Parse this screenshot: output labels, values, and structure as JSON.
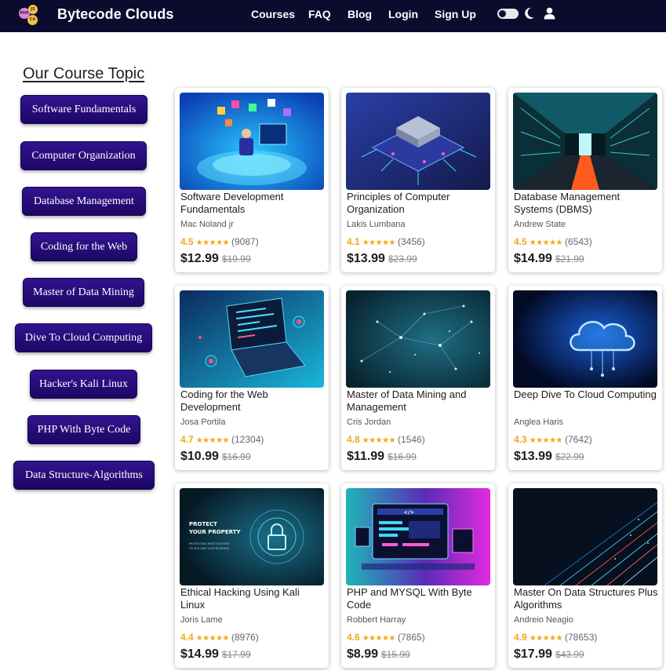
{
  "header": {
    "brand": "Bytecode Clouds",
    "logo_badges": [
      "PHP",
      "JS",
      "C#"
    ],
    "nav": [
      "Courses",
      "FAQ",
      "Blog",
      "Login",
      "Sign Up"
    ],
    "icons": [
      "theme-toggle",
      "moon-icon",
      "user-icon"
    ]
  },
  "sidebar": {
    "heading": "Our Course Topic",
    "topics": [
      "Software Fundamentals",
      "Computer Organization",
      "Database Management",
      "Coding for the Web",
      "Master of Data Mining",
      "Dive To Cloud Computing",
      "Hacker's Kali Linux",
      "PHP With Byte Code",
      "Data Structure-Algorithms"
    ]
  },
  "courses": [
    {
      "title": "Software Development Fundamentals",
      "author": "Mac Noland jr",
      "rating": "4.5",
      "reviews": "(9087)",
      "price": "$12.99",
      "old_price": "$19.99",
      "image": "developer-illustration"
    },
    {
      "title": "Principles of Computer Organization",
      "author": "Lakis Lumbana",
      "rating": "4.1",
      "reviews": "(3456)",
      "price": "$13.99",
      "old_price": "$23.99",
      "image": "cpu-chip"
    },
    {
      "title": "Database Management Systems (DBMS)",
      "author": "Andrew State",
      "rating": "4.5",
      "reviews": "(6543)",
      "price": "$14.99",
      "old_price": "$21.99",
      "image": "server-room"
    },
    {
      "title": "Coding for the Web Development",
      "author": "Josa Portila",
      "rating": "4.7",
      "reviews": "(12304)",
      "price": "$10.99",
      "old_price": "$16.99",
      "image": "laptop-code"
    },
    {
      "title": "Master of Data Mining and Management",
      "author": "Cris Jordan",
      "rating": "4.8",
      "reviews": "(1546)",
      "price": "$11.99",
      "old_price": "$16.99",
      "image": "data-particles"
    },
    {
      "title": "Deep Dive To Cloud Computing",
      "author": "Anglea Haris",
      "rating": "4.3",
      "reviews": "(7642)",
      "price": "$13.99",
      "old_price": "$22.99",
      "image": "cloud-circuit"
    },
    {
      "title": "Ethical Hacking Using Kali Linux",
      "author": "Joris Lame",
      "rating": "4.4",
      "reviews": "(8976)",
      "price": "$14.99",
      "old_price": "$17.99",
      "image": "security-lock"
    },
    {
      "title": "PHP and MYSQL With Byte Code",
      "author": "Robbert Harray",
      "rating": "4.6",
      "reviews": "(7865)",
      "price": "$8.99",
      "old_price": "$15.99",
      "image": "code-screens"
    },
    {
      "title": "Master On Data Structures Plus Algorithms",
      "author": "Andreio Neagio",
      "rating": "4.9",
      "reviews": "(78653)",
      "price": "$17.99",
      "old_price": "$43.99",
      "image": "light-streaks"
    }
  ],
  "thumb_texts": {
    "lock_line1": "PROTECT",
    "lock_line2": "YOUR PROPERTY",
    "lock_line3": "PROTECTING WHAT MATTERS",
    "lock_line4": "TO YOU AND YOUR BUSINESS",
    "code_tag": "</>"
  },
  "colors": {
    "navbar": "#0b0b2e",
    "topic_button": "#2a0f85",
    "star": "#f0a817"
  }
}
